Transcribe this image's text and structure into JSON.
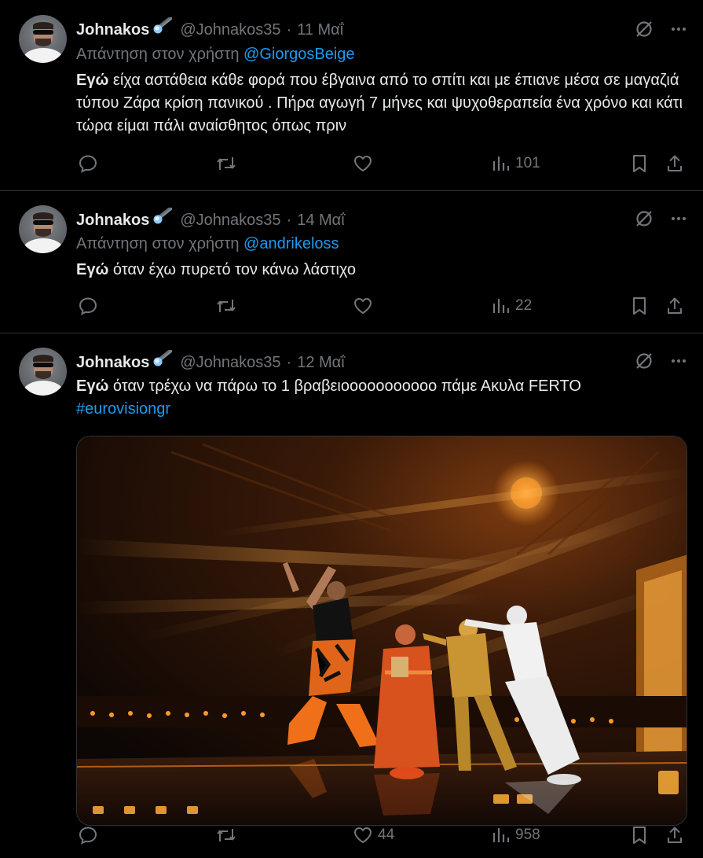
{
  "colors": {
    "background": "#000000",
    "text": "#e7e9ea",
    "muted": "#71767b",
    "link": "#1d9bf0",
    "divider": "#2f3336"
  },
  "icons": {
    "badge": "comet-icon",
    "grok": "grok-icon",
    "more": "more-icon",
    "reply": "reply-icon",
    "retweet": "retweet-icon",
    "like": "heart-icon",
    "views": "views-icon",
    "bookmark": "bookmark-icon",
    "share": "share-icon"
  },
  "tweets": [
    {
      "display_name": "Johnakos",
      "handle": "@Johnakos35",
      "separator": "·",
      "date": "11 Μαΐ",
      "reply_prefix": "Απάντηση στον χρήστη",
      "reply_to": "@GiorgosBeige",
      "text_bold": "Εγώ",
      "text_rest": " είχα αστάθεια κάθε φορά που έβγαινα από το σπίτι και με έπιανε μέσα σε μαγαζιά τύπου Ζάρα κρίση πανικού . Πήρα αγωγή 7 μήνες και ψυχοθεραπεία ένα χρόνο και κάτι τώρα είμαι πάλι αναίσθητος όπως πριν",
      "views": "101"
    },
    {
      "display_name": "Johnakos",
      "handle": "@Johnakos35",
      "separator": "·",
      "date": "14 Μαΐ",
      "reply_prefix": "Απάντηση στον χρήστη",
      "reply_to": "@andrikeloss",
      "text_bold": "Εγώ",
      "text_rest": " όταν έχω πυρετό τον κάνω λάστιχο",
      "views": "22"
    },
    {
      "display_name": "Johnakos",
      "handle": "@Johnakos35",
      "separator": "·",
      "date": "12 Μαΐ",
      "text_bold": "Εγώ",
      "text_rest": " όταν τρέχω να πάρω το 1 βραβειοοοοοοοοοοο πάμε Ακυλα FERTO",
      "hashtag": "#eurovisiongr",
      "likes": "44",
      "views": "958"
    }
  ]
}
